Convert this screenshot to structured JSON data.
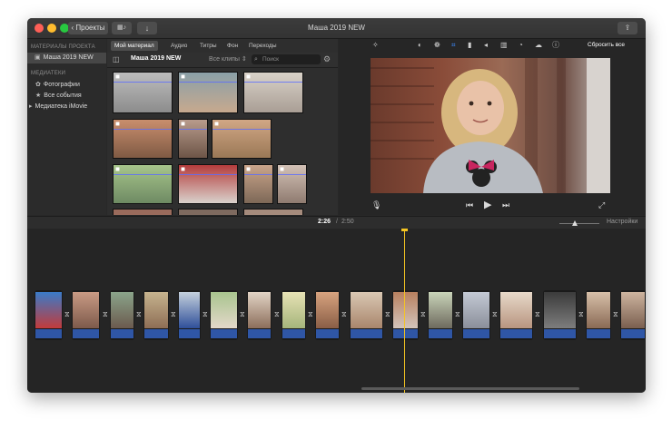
{
  "window": {
    "title": "Маша 2019 NEW",
    "projects_button": "‹ Проекты",
    "media_button_icon": "film-grid-icon",
    "import_button_icon": "download-arrow-icon",
    "share_button_icon": "share-icon"
  },
  "sidebar": {
    "project_header": "МАТЕРИАЛЫ ПРОЕКТА",
    "project_item": "Маша 2019 NEW",
    "libraries_header": "МЕДИАТЕКИ",
    "items": [
      {
        "label": "Фотографии",
        "icon": "photos-icon"
      },
      {
        "label": "Все события",
        "icon": "events-icon"
      },
      {
        "label": "Медиатека iMovie",
        "icon": "disclosure-triangle-icon"
      }
    ]
  },
  "browser": {
    "tabs": [
      "Мой материал",
      "Аудио",
      "Титры",
      "Фон",
      "Переходы"
    ],
    "library_name": "Маша 2019 NEW",
    "clip_filter": "Все клипы ⇕",
    "search_placeholder": "Поиск"
  },
  "viewer": {
    "reset_label": "Сбросить все",
    "tools": [
      "magic-wand-icon",
      "color-balance-icon",
      "color-correction-icon",
      "crop-icon",
      "stabilization-icon",
      "volume-icon",
      "equalizer-icon",
      "speed-icon",
      "noise-reduction-icon",
      "info-icon"
    ]
  },
  "timeline": {
    "current_time": "2:26",
    "separator": "/",
    "total_time": "2:50",
    "settings_label": "Настройки"
  },
  "colors": {
    "accent": "#2f56a6",
    "playhead": "#f5c522",
    "selected_tool": "#3d8bff"
  }
}
